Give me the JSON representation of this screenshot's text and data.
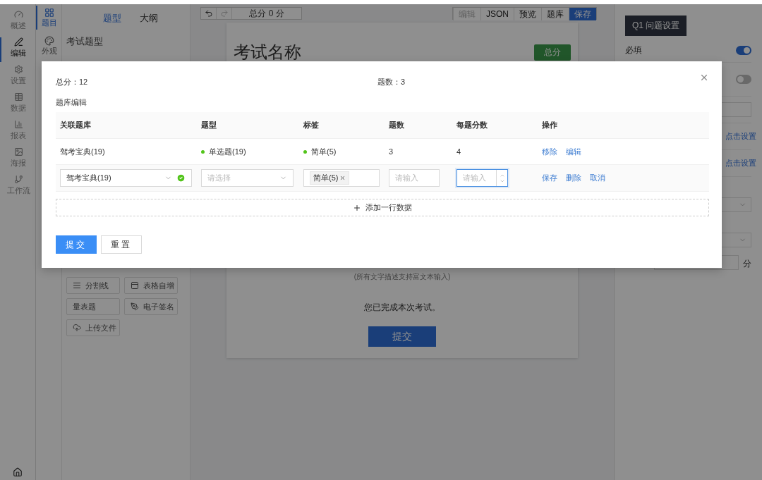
{
  "nav_rail": [
    {
      "label": "概述",
      "selected": false
    },
    {
      "label": "编辑",
      "selected": true
    },
    {
      "label": "设置",
      "selected": false
    },
    {
      "label": "数据",
      "selected": false
    },
    {
      "label": "报表",
      "selected": false
    },
    {
      "label": "海报",
      "selected": false
    },
    {
      "label": "工作流",
      "selected": false
    }
  ],
  "sub_rail": [
    {
      "label": "题目",
      "selected": true
    },
    {
      "label": "外观",
      "selected": false
    }
  ],
  "palette": {
    "tabs": [
      {
        "label": "题型",
        "selected": true
      },
      {
        "label": "大纲",
        "selected": false
      }
    ],
    "section_title": "考试题型",
    "items": [
      {
        "label": "分割线"
      },
      {
        "label": "表格自增"
      },
      {
        "label": "量表题"
      },
      {
        "label": "电子签名"
      },
      {
        "label": "上传文件"
      }
    ]
  },
  "toolbar": {
    "score": "总分 0 分",
    "actions": [
      {
        "label": "编辑",
        "kind": "default",
        "disabled": true
      },
      {
        "label": "JSON",
        "kind": "default",
        "disabled": false
      },
      {
        "label": "预览",
        "kind": "default",
        "disabled": false
      },
      {
        "label": "题库",
        "kind": "default",
        "disabled": false
      },
      {
        "label": "保存",
        "kind": "primary",
        "disabled": false
      }
    ]
  },
  "canvas": {
    "title": "考试名称",
    "score_badge": "总分",
    "note": "(所有文字描述支持富文本输入)",
    "end_message": "您已完成本次考试。",
    "submit": "提交"
  },
  "settings": {
    "heading": "Q1 问题设置",
    "toggles": [
      {
        "label": "必填",
        "on": true
      },
      {
        "on": false
      }
    ],
    "links": [
      "点击设置",
      "点击设置"
    ],
    "unit": "分"
  },
  "modal": {
    "total": "总分：12",
    "count": "题数：3",
    "section_title": "题库编辑",
    "columns": [
      "关联题库",
      "题型",
      "标签",
      "题数",
      "每题分数",
      "操作"
    ],
    "rows": [
      {
        "bank": "驾考宝典(19)",
        "type": "单选题(19)",
        "tag": "简单(5)",
        "count": "3",
        "score": "4",
        "actions": [
          "移除",
          "编辑"
        ]
      }
    ],
    "editor": {
      "fields": [
        {
          "kind": "select",
          "value": "驾考宝典(19)",
          "valid": true
        },
        {
          "kind": "select",
          "placeholder": "请选择",
          "valid": false
        },
        {
          "kind": "tags",
          "tags": [
            "简单(5)"
          ]
        },
        {
          "kind": "input",
          "placeholder": "请输入",
          "focused": false
        },
        {
          "kind": "number",
          "placeholder": "请输入",
          "focused": true
        }
      ],
      "actions": [
        "保存",
        "删除",
        "取消"
      ]
    },
    "add_row": "添加一行数据",
    "buttons": [
      {
        "label": "提交",
        "kind": "primary"
      },
      {
        "label": "重置",
        "kind": "default"
      }
    ]
  }
}
